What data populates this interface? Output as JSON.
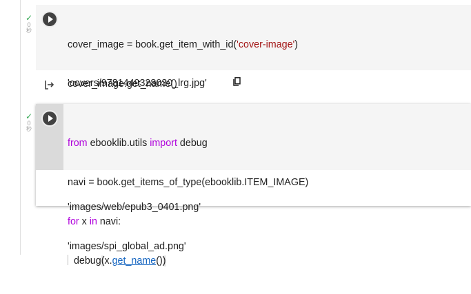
{
  "cell1": {
    "exec_status": {
      "check": "✓",
      "count": "0",
      "unit": "秒"
    },
    "code": {
      "line1": {
        "a": "cover_image = book.get_item_with_id(",
        "s": "'cover-image'",
        "b": ")"
      },
      "line2": "cover_image.get_name()"
    },
    "output": {
      "text": "'covers/9781449328030_lrg.jpg'"
    }
  },
  "cell2": {
    "exec_status": {
      "check": "✓",
      "count": "0",
      "unit": "秒"
    },
    "code": {
      "line1": {
        "kw1": "from",
        "mid": " ebooklib.utils ",
        "kw2": "import",
        "end": " debug"
      },
      "line2": "navi = book.get_items_of_type(ebooklib.ITEM_IMAGE)",
      "line3": {
        "kw1": "for",
        "mid": " x ",
        "kw2": "in",
        "end": " navi:"
      },
      "line4": {
        "pre": "debug",
        "paren": "(",
        "obj": "x.",
        "link": "get_name",
        "post": "()",
        "close": ")"
      }
    },
    "output": [
      "'images/web/epub3_0401.png'",
      "'images/spi_global_ad.png'"
    ]
  },
  "icons": {
    "run": "play-circle-icon",
    "output": "output-arrow-icon",
    "copy": "copy-icon"
  },
  "colors": {
    "string": "#a31515",
    "keyword": "#af00db",
    "link": "#1565c0",
    "check": "#34a853"
  }
}
